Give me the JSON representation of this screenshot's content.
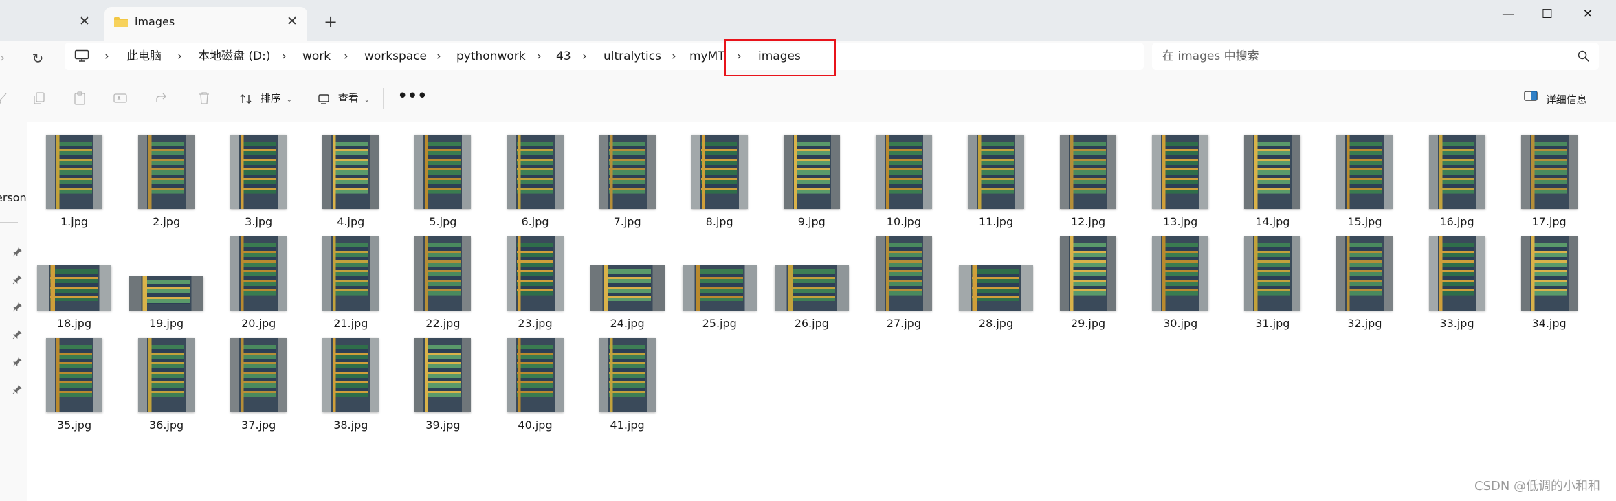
{
  "tabs": {
    "previous_close": "✕",
    "active_label": "images",
    "active_close": "✕",
    "new_tab": "+"
  },
  "window_controls": {
    "minimize": "—",
    "maximize": "☐",
    "close": "✕"
  },
  "address": {
    "crumbs": [
      "此电脑",
      "本地磁盘 (D:)",
      "work",
      "workspace",
      "pythonwork",
      "43",
      "ultralytics",
      "myMT",
      "images"
    ],
    "separator": "›"
  },
  "search": {
    "placeholder": "在 images 中搜索"
  },
  "toolbar": {
    "sort_label": "排序",
    "view_label": "查看",
    "more": "•••",
    "details_label": "详细信息"
  },
  "sidebar": {
    "partial_label": "erson"
  },
  "files": [
    {
      "name": "1.jpg",
      "orientation": "portrait"
    },
    {
      "name": "2.jpg",
      "orientation": "portrait"
    },
    {
      "name": "3.jpg",
      "orientation": "portrait"
    },
    {
      "name": "4.jpg",
      "orientation": "portrait"
    },
    {
      "name": "5.jpg",
      "orientation": "portrait"
    },
    {
      "name": "6.jpg",
      "orientation": "portrait"
    },
    {
      "name": "7.jpg",
      "orientation": "portrait"
    },
    {
      "name": "8.jpg",
      "orientation": "portrait"
    },
    {
      "name": "9.jpg",
      "orientation": "portrait"
    },
    {
      "name": "10.jpg",
      "orientation": "portrait"
    },
    {
      "name": "11.jpg",
      "orientation": "portrait"
    },
    {
      "name": "12.jpg",
      "orientation": "portrait"
    },
    {
      "name": "13.jpg",
      "orientation": "portrait"
    },
    {
      "name": "14.jpg",
      "orientation": "portrait"
    },
    {
      "name": "15.jpg",
      "orientation": "portrait"
    },
    {
      "name": "16.jpg",
      "orientation": "portrait"
    },
    {
      "name": "17.jpg",
      "orientation": "portrait"
    },
    {
      "name": "18.jpg",
      "orientation": "landscape"
    },
    {
      "name": "19.jpg",
      "orientation": "landscape-wide"
    },
    {
      "name": "20.jpg",
      "orientation": "portrait"
    },
    {
      "name": "21.jpg",
      "orientation": "portrait"
    },
    {
      "name": "22.jpg",
      "orientation": "portrait"
    },
    {
      "name": "23.jpg",
      "orientation": "portrait"
    },
    {
      "name": "24.jpg",
      "orientation": "landscape"
    },
    {
      "name": "25.jpg",
      "orientation": "landscape"
    },
    {
      "name": "26.jpg",
      "orientation": "landscape"
    },
    {
      "name": "27.jpg",
      "orientation": "portrait"
    },
    {
      "name": "28.jpg",
      "orientation": "landscape"
    },
    {
      "name": "29.jpg",
      "orientation": "portrait"
    },
    {
      "name": "30.jpg",
      "orientation": "portrait"
    },
    {
      "name": "31.jpg",
      "orientation": "portrait"
    },
    {
      "name": "32.jpg",
      "orientation": "portrait"
    },
    {
      "name": "33.jpg",
      "orientation": "portrait"
    },
    {
      "name": "34.jpg",
      "orientation": "portrait"
    },
    {
      "name": "35.jpg",
      "orientation": "portrait"
    },
    {
      "name": "36.jpg",
      "orientation": "portrait"
    },
    {
      "name": "37.jpg",
      "orientation": "portrait"
    },
    {
      "name": "38.jpg",
      "orientation": "portrait"
    },
    {
      "name": "39.jpg",
      "orientation": "portrait"
    },
    {
      "name": "40.jpg",
      "orientation": "portrait"
    },
    {
      "name": "41.jpg",
      "orientation": "portrait"
    }
  ],
  "watermark": "CSDN @低调的小和和",
  "colors": {
    "titlebar": "#e8ebee",
    "surface": "#f9f9f9",
    "highlight_box": "#e8141b",
    "folder": "#f2c744",
    "cabinet_gray": "#9aa0a3",
    "panel_orange": "#d4a23a",
    "panel_green": "#3f8f5a"
  },
  "icons": [
    "close-icon",
    "folder-icon",
    "plus-icon",
    "minimize-icon",
    "maximize-icon",
    "refresh-icon",
    "this-pc-icon",
    "chevron-right-icon",
    "search-icon",
    "cut-icon",
    "copy-icon",
    "paste-icon",
    "rename-icon",
    "share-icon",
    "delete-icon",
    "sort-icon",
    "view-icon",
    "more-icon",
    "details-pane-icon",
    "pin-icon",
    "image-thumbnail"
  ]
}
